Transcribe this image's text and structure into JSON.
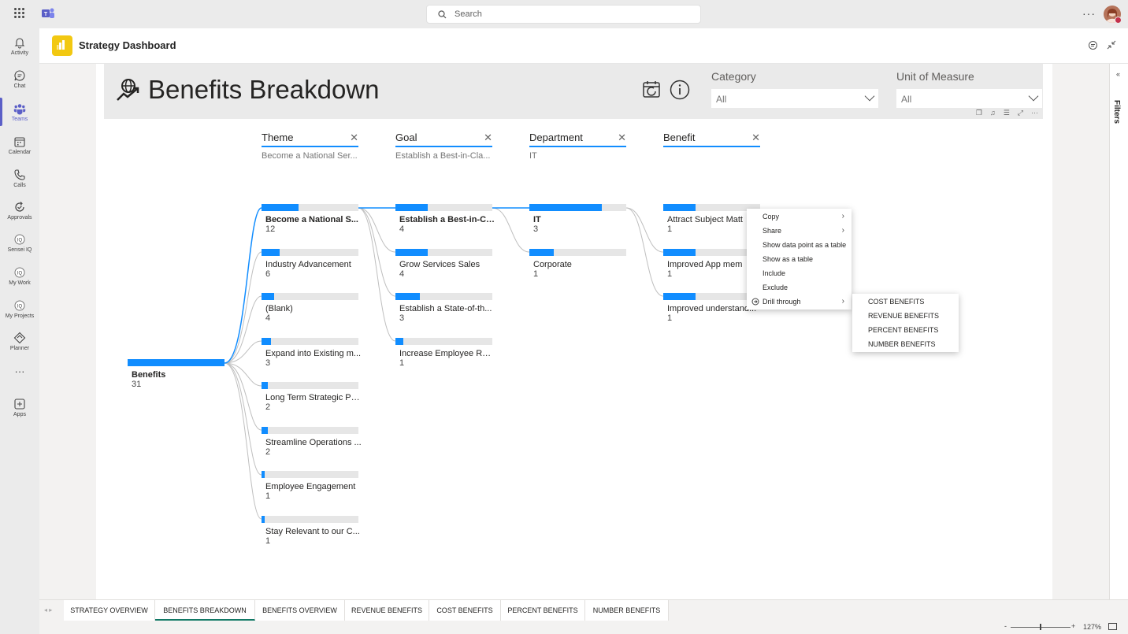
{
  "topbar": {
    "search_placeholder": "Search",
    "more": "···"
  },
  "rail": {
    "items": [
      {
        "label": "Activity",
        "icon": "bell-icon"
      },
      {
        "label": "Chat",
        "icon": "chat-icon"
      },
      {
        "label": "Teams",
        "icon": "teams-icon"
      },
      {
        "label": "Calendar",
        "icon": "calendar-icon"
      },
      {
        "label": "Calls",
        "icon": "phone-icon"
      },
      {
        "label": "Approvals",
        "icon": "approvals-icon"
      },
      {
        "label": "Sensei IQ",
        "icon": "iq-icon"
      },
      {
        "label": "My Work",
        "icon": "iq-icon"
      },
      {
        "label": "My Projects",
        "icon": "iq-icon"
      },
      {
        "label": "Planner",
        "icon": "planner-icon"
      },
      {
        "label": "···",
        "icon": "more-icon"
      },
      {
        "label": "Apps",
        "icon": "apps-icon"
      }
    ],
    "active": "Teams"
  },
  "app": {
    "title": "Strategy Dashboard"
  },
  "report": {
    "title": "Benefits Breakdown",
    "category_label": "Category",
    "category_value": "All",
    "unit_label": "Unit of Measure",
    "unit_value": "All"
  },
  "tree": {
    "root": {
      "label": "Benefits",
      "value": "31"
    },
    "levels": [
      {
        "title": "Theme",
        "selected": "Become a National Ser..."
      },
      {
        "title": "Goal",
        "selected": "Establish a Best-in-Cla..."
      },
      {
        "title": "Department",
        "selected": "IT"
      },
      {
        "title": "Benefit",
        "selected": ""
      }
    ],
    "theme_nodes": [
      {
        "label": "Become a National S...",
        "value": "12"
      },
      {
        "label": "Industry Advancement",
        "value": "6"
      },
      {
        "label": "(Blank)",
        "value": "4"
      },
      {
        "label": "Expand into Existing m...",
        "value": "3"
      },
      {
        "label": "Long Term Strategic Pa...",
        "value": "2"
      },
      {
        "label": "Streamline Operations ...",
        "value": "2"
      },
      {
        "label": "Employee Engagement",
        "value": "1"
      },
      {
        "label": "Stay Relevant to our C...",
        "value": "1"
      }
    ],
    "goal_nodes": [
      {
        "label": "Establish a Best-in-Cl...",
        "value": "4"
      },
      {
        "label": "Grow Services Sales",
        "value": "4"
      },
      {
        "label": "Establish a State-of-th...",
        "value": "3"
      },
      {
        "label": "Increase Employee Ret...",
        "value": "1"
      }
    ],
    "dept_nodes": [
      {
        "label": "IT",
        "value": "3"
      },
      {
        "label": "Corporate",
        "value": "1"
      }
    ],
    "benefit_nodes": [
      {
        "label": "Attract Subject Matt",
        "value": "1"
      },
      {
        "label": "Improved App mem",
        "value": "1"
      },
      {
        "label": "Improved understand...",
        "value": "1"
      }
    ]
  },
  "context_menu": {
    "items": [
      "Copy",
      "Share",
      "Show data point as a table",
      "Show as a table",
      "Include",
      "Exclude",
      "Drill through"
    ]
  },
  "drill_submenu": {
    "items": [
      "COST BENEFITS",
      "REVENUE BENEFITS",
      "PERCENT BENEFITS",
      "NUMBER BENEFITS"
    ]
  },
  "tabs": [
    "STRATEGY OVERVIEW",
    "BENEFITS BREAKDOWN",
    "BENEFITS OVERVIEW",
    "REVENUE BENEFITS",
    "COST BENEFITS",
    "PERCENT BENEFITS",
    "NUMBER BENEFITS"
  ],
  "active_tab": "BENEFITS BREAKDOWN",
  "status": {
    "zoom": "127%"
  },
  "filters_pane": {
    "label": "Filters"
  },
  "colors": {
    "accent": "#118dff",
    "teams": "#5b5fc7",
    "tab_active": "#117865",
    "pbi": "#f2c811"
  }
}
